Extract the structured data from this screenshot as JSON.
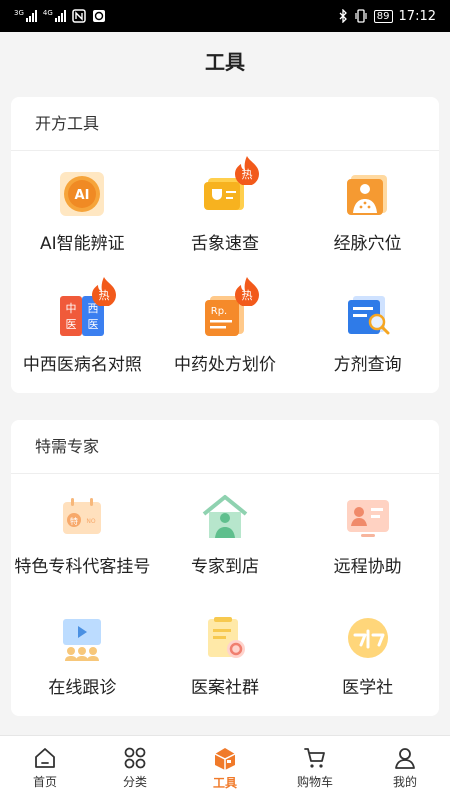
{
  "status": {
    "net1": "3G",
    "net2": "4G",
    "battery": "89",
    "time": "17:12"
  },
  "header": {
    "title": "工具"
  },
  "sections": [
    {
      "title": "开方工具",
      "items": [
        {
          "label": "AI智能辨证",
          "icon": "ai-diagnosis-icon",
          "hot": false
        },
        {
          "label": "舌象速查",
          "icon": "tongue-check-icon",
          "hot": true
        },
        {
          "label": "经脉穴位",
          "icon": "meridian-acupoint-icon",
          "hot": false
        },
        {
          "label": "中西医病名对照",
          "icon": "disease-name-compare-icon",
          "hot": true
        },
        {
          "label": "中药处方划价",
          "icon": "prescription-price-icon",
          "hot": true
        },
        {
          "label": "方剂查询",
          "icon": "formula-search-icon",
          "hot": false
        }
      ],
      "hot_text": "热"
    },
    {
      "title": "特需专家",
      "items": [
        {
          "label": "特色专科代客挂号",
          "icon": "special-registration-icon"
        },
        {
          "label": "专家到店",
          "icon": "expert-visit-icon"
        },
        {
          "label": "远程协助",
          "icon": "remote-assist-icon"
        },
        {
          "label": "在线跟诊",
          "icon": "online-follow-icon"
        },
        {
          "label": "医案社群",
          "icon": "case-community-icon"
        },
        {
          "label": "医学社",
          "icon": "medical-club-icon"
        }
      ]
    }
  ],
  "tabs": [
    {
      "label": "首页",
      "icon": "home-icon",
      "active": false
    },
    {
      "label": "分类",
      "icon": "category-icon",
      "active": false
    },
    {
      "label": "工具",
      "icon": "toolbox-icon",
      "active": true
    },
    {
      "label": "购物车",
      "icon": "cart-icon",
      "active": false
    },
    {
      "label": "我的",
      "icon": "profile-icon",
      "active": false
    }
  ],
  "colors": {
    "accent": "#f07a2a",
    "hot": "#f25a1b"
  }
}
